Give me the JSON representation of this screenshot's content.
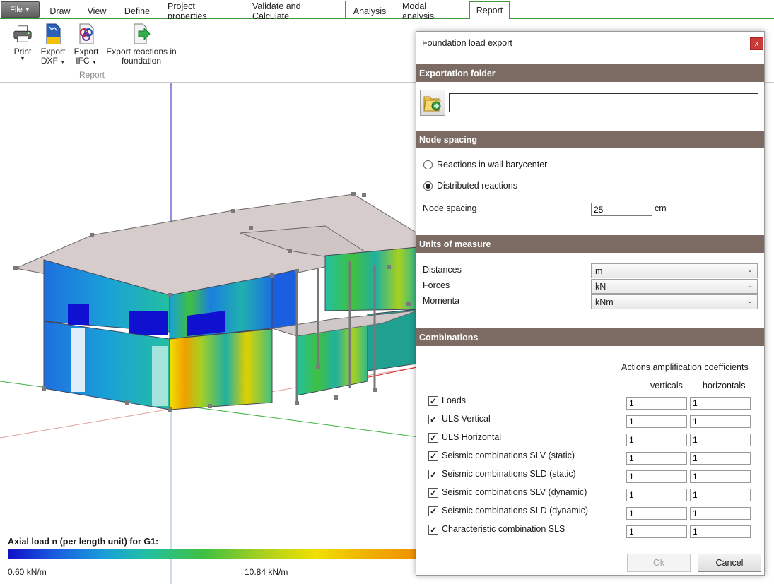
{
  "ribbon": {
    "file_label": "File",
    "tabs": [
      "Draw",
      "View",
      "Define",
      "Project properties",
      "Validate and Calculate",
      "Analysis",
      "Modal analysis",
      "Report"
    ],
    "active_tab": "Report",
    "buttons": {
      "print": "Print",
      "export_dxf_1": "Export",
      "export_dxf_2": "DXF",
      "export_ifc_1": "Export",
      "export_ifc_2": "IFC",
      "export_reactions_1": "Export reactions in",
      "export_reactions_2": "foundation"
    },
    "group_label": "Report"
  },
  "viewport": {
    "legend_title": "Axial load n (per length unit) for G1:",
    "legend_min": "0.60 kN/m",
    "legend_mid": "10.84 kN/m"
  },
  "dialog": {
    "title": "Foundation load export",
    "close_label": "x",
    "sections": {
      "folder": "Exportation folder",
      "spacing": "Node spacing",
      "units": "Units of measure",
      "combinations": "Combinations"
    },
    "folder_value": "",
    "radio_barycenter": "Reactions in wall barycenter",
    "radio_distributed": "Distributed reactions",
    "selected_radio": "distributed",
    "node_spacing_label": "Node spacing",
    "node_spacing_value": "25",
    "node_spacing_unit": "cm",
    "units": [
      {
        "label": "Distances",
        "value": "m"
      },
      {
        "label": "Forces",
        "value": "kN"
      },
      {
        "label": "Momenta",
        "value": "kNm"
      }
    ],
    "coef_header": "Actions amplification coefficients",
    "col_verticals": "verticals",
    "col_horizontals": "horizontals",
    "combinations": [
      {
        "label": "Loads",
        "checked": true,
        "vertical": "1",
        "horizontal": "1"
      },
      {
        "label": "ULS Vertical",
        "checked": true,
        "vertical": "1",
        "horizontal": "1"
      },
      {
        "label": "ULS Horizontal",
        "checked": true,
        "vertical": "1",
        "horizontal": "1"
      },
      {
        "label": "Seismic combinations SLV (static)",
        "checked": true,
        "vertical": "1",
        "horizontal": "1"
      },
      {
        "label": "Seismic combinations SLD (static)",
        "checked": true,
        "vertical": "1",
        "horizontal": "1"
      },
      {
        "label": "Seismic combinations SLV (dynamic)",
        "checked": true,
        "vertical": "1",
        "horizontal": "1"
      },
      {
        "label": "Seismic combinations SLD (dynamic)",
        "checked": true,
        "vertical": "1",
        "horizontal": "1"
      },
      {
        "label": "Characteristic combination SLS",
        "checked": true,
        "vertical": "1",
        "horizontal": "1"
      }
    ],
    "ok_label": "Ok",
    "cancel_label": "Cancel"
  }
}
